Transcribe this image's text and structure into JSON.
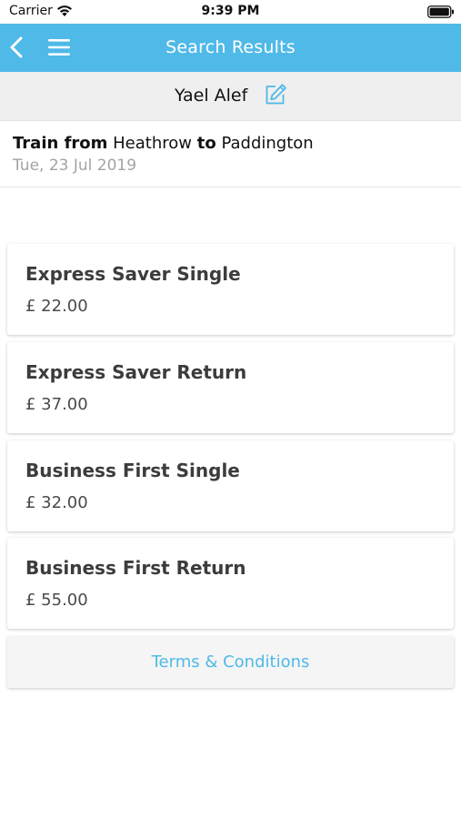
{
  "status_bar": {
    "carrier": "Carrier",
    "time": "9:39 PM",
    "icons": [
      "wifi-icon",
      "battery-icon"
    ]
  },
  "nav": {
    "title": "Search Results",
    "back_icon": "back-chevron-icon",
    "menu_icon": "hamburger-menu-icon",
    "background_color": "#4fb9e8"
  },
  "passenger": {
    "name": "Yael Alef",
    "edit_icon": "edit-icon"
  },
  "journey": {
    "prefix": "Train from",
    "origin": "Heathrow",
    "connector": "to",
    "destination": "Paddington",
    "date": "Tue, 23 Jul 2019"
  },
  "fares": [
    {
      "name": "Express Saver Single",
      "price": "£ 22.00"
    },
    {
      "name": "Express Saver Return",
      "price": "£ 37.00"
    },
    {
      "name": "Business First Single",
      "price": "£ 32.00"
    },
    {
      "name": "Business First Return",
      "price": "£ 55.00"
    }
  ],
  "terms": {
    "label": "Terms & Conditions",
    "color": "#4fb9e8"
  }
}
